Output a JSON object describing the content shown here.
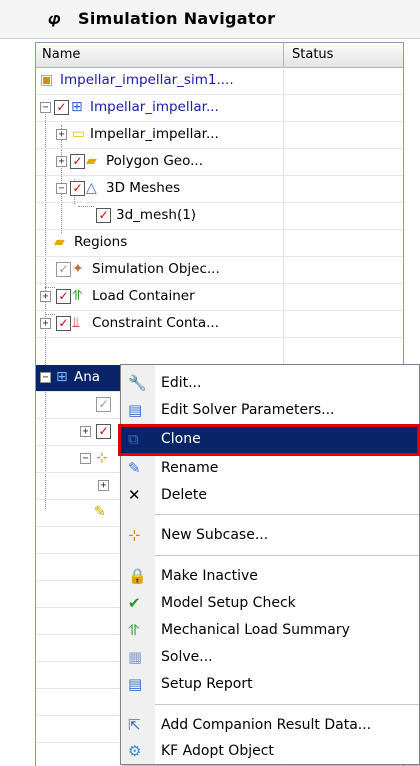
{
  "panel": {
    "title": "Simulation Navigator"
  },
  "columns": {
    "name": "Name",
    "status": "Status"
  },
  "tree": {
    "root": "Impellar_impellar_sim1....",
    "fem": "Impellar_impellar...",
    "prt": "Impellar_impellar...",
    "polygon": "Polygon Geo...",
    "meshes": "3D Meshes",
    "mesh": "3d_mesh(1)",
    "regions": "Regions",
    "sim_objects": "Simulation Objec...",
    "load_container": "Load Container",
    "constraint_container": "Constraint Conta...",
    "analysis": "Ana"
  },
  "menu": {
    "edit": "Edit...",
    "edit_solver": "Edit Solver Parameters...",
    "clone": "Clone",
    "rename": "Rename",
    "delete": "Delete",
    "new_subcase": "New Subcase...",
    "make_inactive": "Make Inactive",
    "model_setup_check": "Model Setup Check",
    "mech_load_summary": "Mechanical Load Summary",
    "solve": "Solve...",
    "setup_report": "Setup Report",
    "add_companion": "Add Companion Result Data...",
    "kf_adopt": "KF Adopt Object"
  }
}
